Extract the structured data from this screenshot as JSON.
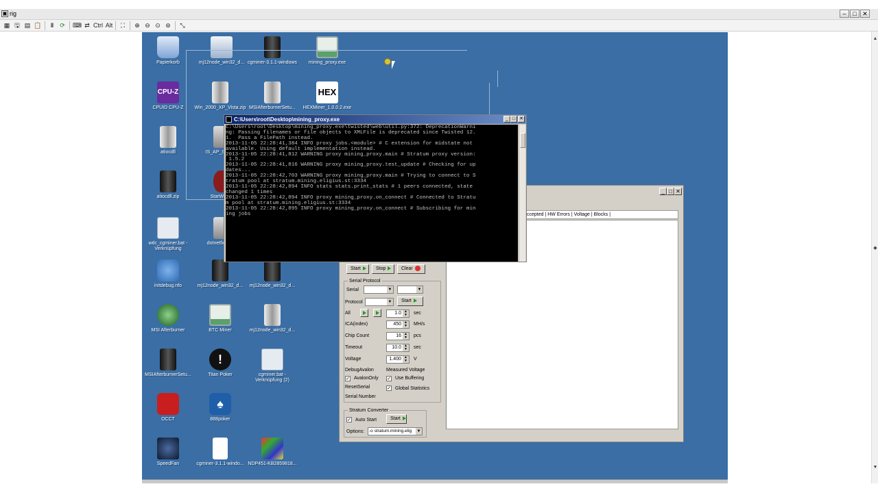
{
  "viewer": {
    "title": "rig",
    "toolbar_icons": [
      "logo-icon",
      "save-icon",
      "options-icon",
      "clipboard-icon",
      "pause-icon",
      "refresh-icon",
      "keyboard-icon",
      "send-icon",
      "ctrl-key",
      "alt-key",
      "fullscreen-icon",
      "zoom-in-icon",
      "zoom-out-icon",
      "zoom-reset-icon",
      "zoom-fit-icon",
      "scale-icon"
    ],
    "ctrl_label": "Ctrl",
    "alt_label": "Alt"
  },
  "desktop_icons": [
    {
      "label": "Papierkorb",
      "icon": "recycle-bin-icon",
      "color": "#8fb4e0"
    },
    {
      "label": "mj12node_win32_d...",
      "icon": "network-computer-icon",
      "color": "#cfd8e6"
    },
    {
      "label": "cgminer-3.1.1-windows",
      "icon": "archive-icon",
      "color": "#2a2a2a"
    },
    {
      "label": "mining_proxy.exe",
      "icon": "console-app-icon",
      "color": "#5aa16a"
    },
    {
      "label": "CPUID CPU-Z",
      "icon": "cpuz-icon",
      "color": "#6a2b9e"
    },
    {
      "label": "Win_2000_XP_Vista.zip",
      "icon": "zip-icon",
      "color": "#c8c8c8"
    },
    {
      "label": "MSIAfterburnerSetu...",
      "icon": "zip-icon",
      "color": "#c8c8c8"
    },
    {
      "label": "HEXMiner_1.0.0.2.exe",
      "icon": "hex-icon",
      "color": "#000000"
    },
    {
      "label": "atiocdll",
      "icon": "archive-icon",
      "color": "#c8c8c8"
    },
    {
      "label": "IS_AP_STA...",
      "icon": "app-icon",
      "color": "#c8c8c8"
    },
    {
      "label": "atiocdll.zip",
      "icon": "archive-icon",
      "color": "#2a2a2a"
    },
    {
      "label": "StarWind",
      "icon": "starwind-icon",
      "color": "#8a1c1c"
    },
    {
      "label": "wdc_cgminer.bat - Verknüpfung",
      "icon": "gear-shortcut-icon",
      "color": "#cfd8e6"
    },
    {
      "label": "dotnetfx45...",
      "icon": "installer-icon",
      "color": "#c8c8c8"
    },
    {
      "label": "initdebug.nfo",
      "icon": "sysinfo-icon",
      "color": "#2f6db5"
    },
    {
      "label": "mj12node_win32_d...",
      "icon": "archive-icon",
      "color": "#2a2a2a"
    },
    {
      "label": "mj12node_win32_d...",
      "icon": "archive-icon",
      "color": "#2a2a2a"
    },
    {
      "label": "MSI Afterburner",
      "icon": "afterburner-icon",
      "color": "#2a8a2a"
    },
    {
      "label": "BTC Miner",
      "icon": "console-app-icon",
      "color": "#5aa16a"
    },
    {
      "label": "mj12node_win32_d...",
      "icon": "zip-icon",
      "color": "#c8c8c8"
    },
    {
      "label": "MSIAfterburnerSetu...",
      "icon": "archive-icon",
      "color": "#2a2a2a"
    },
    {
      "label": "Titan Poker",
      "icon": "titan-poker-icon",
      "color": "#111111"
    },
    {
      "label": "cgminer.bat - Verknüpfung (2)",
      "icon": "gear-shortcut-icon",
      "color": "#cfd8e6"
    },
    {
      "label": "OCCT",
      "icon": "occt-icon",
      "color": "#c81e1e"
    },
    {
      "label": "888poker",
      "icon": "poker-icon",
      "color": "#1e5fa8"
    },
    {
      "label": "SpeedFan",
      "icon": "fan-icon",
      "color": "#1a2a4a"
    },
    {
      "label": "cgminer-3.1.1-windo...",
      "icon": "document-icon",
      "color": "#ffffff"
    },
    {
      "label": "NDP451-KB2859818...",
      "icon": "installer-icon",
      "color": "#c8c8c8"
    }
  ],
  "console": {
    "title": "C:\\Users\\root\\Desktop\\mining_proxy.exe",
    "lines": [
      "C:\\Users\\root\\Desktop\\mining_proxy.exe\\twisted\\web\\util.py:372: DeprecationWarni",
      "ng: Passing filenames or file objects to XMLFile is deprecated since Twisted 12.",
      "1.  Pass a FilePath instead.",
      "2013-11-05 22:28:41,384 INFO proxy jobs.<module> # C extension for midstate not",
      "available. Using default implementation instead.",
      "2013-11-05 22:28:41,812 WARNING proxy mining_proxy.main # Stratum proxy version:",
      " 1.5.2",
      "2013-11-05 22:28:41,816 WARNING proxy mining_proxy.test_update # Checking for up",
      "dates...",
      "2013-11-05 22:28:42,703 WARNING proxy mining_proxy.main # Trying to connect to S",
      "tratum pool at stratum.mining.eligius.st:3334",
      "2013-11-05 22:28:42,894 INFO stats stats.print_stats # 1 peers connected, state",
      "changed 1 times",
      "2013-11-05 22:28:42,894 INFO proxy mining_proxy.on_connect # Connected to Stratu",
      "m pool at stratum.mining.eligius.st:3334",
      "2013-11-05 22:28:42,895 INFO proxy mining_proxy.on_connect # Subscribing for min",
      "ing jobs"
    ]
  },
  "miner": {
    "columns_header": "ccepted | HW Errors | Voltage | Blocks |",
    "start_label": "Start",
    "stop_label": "Stop",
    "clear_label": "Clear",
    "serial_protocol_label": "Serial Protocol",
    "serial_label": "Serial",
    "serial_value": "",
    "serial_value2": "",
    "protocol_label": "Protocol",
    "protocol_value": "",
    "protocol_start_label": "Start",
    "all_label": "All",
    "all_value": "1.0",
    "sec_unit": "sec",
    "ica_label": "ICA(index)",
    "ica_value": "450",
    "mhs_unit": "MH/s",
    "chip_label": "Chip Count",
    "chip_value": "16",
    "pcs_unit": "pcs",
    "timeout_label": "Timeout",
    "timeout_value": "10.0",
    "timeout_unit": "sec",
    "voltage_label": "Voltage",
    "voltage_value": "1.400",
    "voltage_unit": "V",
    "debug_avalon_label": "DebugAvalon",
    "measured_voltage_label": "Measured Voltage",
    "avalon_only_label": "AvalonOnly",
    "use_buffering_label": "Use Buffering",
    "reset_serial_label": "ResetSerial",
    "global_stats_label": "Global Statistics",
    "serial_number_label": "Serial Number",
    "stratum_converter_label": "Stratum Converter",
    "auto_start_label": "Auto Start",
    "stratum_start_label": "Start",
    "options_label": "Options:",
    "options_value": "-o stratum.mining.elig"
  }
}
